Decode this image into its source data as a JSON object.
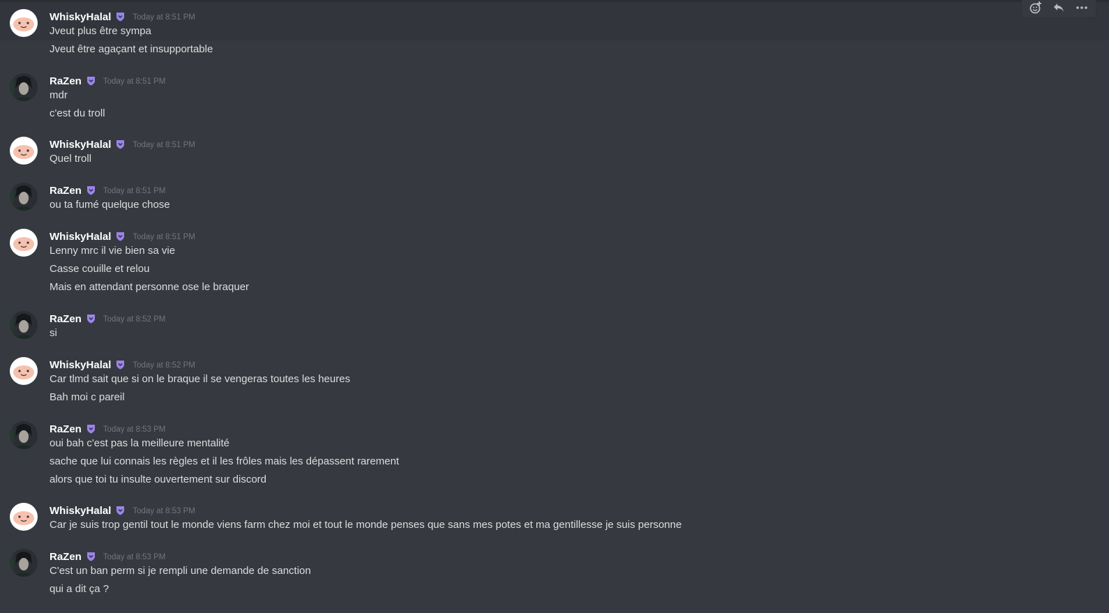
{
  "toolbar": {
    "icons": [
      "add-reaction-icon",
      "reply-icon",
      "more-icon"
    ]
  },
  "users": {
    "whisky": {
      "name": "WhiskyHalal"
    },
    "razen": {
      "name": "RaZen"
    }
  },
  "messages": [
    {
      "user": "WhiskyHalal",
      "timestamp": "Today at 8:51 PM",
      "lines": [
        "Jveut plus être sympa",
        "Jveut être agaçant et insupportable"
      ]
    },
    {
      "user": "RaZen",
      "timestamp": "Today at 8:51 PM",
      "lines": [
        "mdr",
        "c'est du troll"
      ]
    },
    {
      "user": "WhiskyHalal",
      "timestamp": "Today at 8:51 PM",
      "lines": [
        "Quel troll"
      ]
    },
    {
      "user": "RaZen",
      "timestamp": "Today at 8:51 PM",
      "lines": [
        "ou ta fumé quelque chose"
      ]
    },
    {
      "user": "WhiskyHalal",
      "timestamp": "Today at 8:51 PM",
      "lines": [
        "Lenny mrc il vie bien sa vie",
        "Casse couille et relou",
        "Mais en attendant personne ose le braquer"
      ]
    },
    {
      "user": "RaZen",
      "timestamp": "Today at 8:52 PM",
      "lines": [
        "si"
      ]
    },
    {
      "user": "WhiskyHalal",
      "timestamp": "Today at 8:52 PM",
      "lines": [
        "Car tlmd sait que si on le braque il se vengeras toutes les heures",
        "Bah moi c pareil"
      ]
    },
    {
      "user": "RaZen",
      "timestamp": "Today at 8:53 PM",
      "lines": [
        "oui bah c'est pas la meilleure mentalité",
        "sache que lui connais les règles et il les frôles mais les dépassent rarement",
        "alors que toi tu insulte ouvertement sur discord"
      ]
    },
    {
      "user": "WhiskyHalal",
      "timestamp": "Today at 8:53 PM",
      "lines": [
        "Car je suis trop gentil tout le monde viens farm chez moi et tout le monde penses que sans mes potes et ma gentillesse je suis personne"
      ]
    },
    {
      "user": "RaZen",
      "timestamp": "Today at 8:53 PM",
      "lines": [
        "C'est un ban perm si je rempli une demande de sanction",
        "qui a dit ça ?"
      ]
    }
  ],
  "colors": {
    "background": "#36393f",
    "username": "#ffffff",
    "timestamp": "#72767d",
    "message_text": "#dcddde",
    "badge": "#9b84ec"
  }
}
